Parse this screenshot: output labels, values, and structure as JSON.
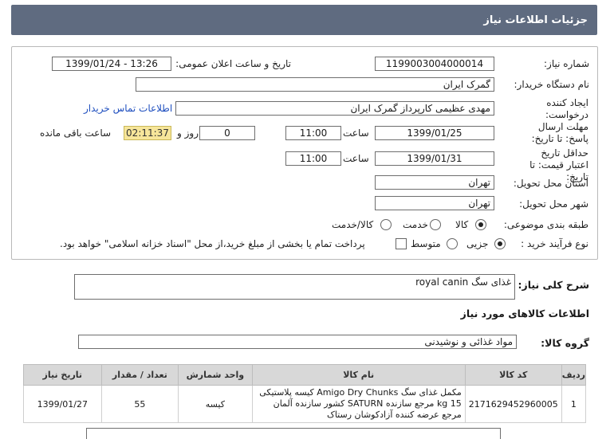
{
  "title": "جزئیات اطلاعات نیاز",
  "labels": {
    "need_number": "شماره نیاز:",
    "announce_datetime": "تاریخ و ساعت اعلان عمومی:",
    "buyer_org": "نام دستگاه خریدار:",
    "requester": "ایجاد کننده درخواست:",
    "contact_info": "اطلاعات تماس خریدار",
    "reply_deadline": "مهلت ارسال پاسخ: تا تاریخ:",
    "time_word": "ساعت",
    "day_and": "روز و",
    "remaining": "ساعت باقی مانده",
    "validity": "حداقل تاریخ اعتبار قیمت: تا تاریخ:",
    "province": "استان محل تحویل:",
    "city": "شهر محل تحویل:",
    "category": "طبقه بندی موضوعی:",
    "purchase_type": "نوع فرآیند خرید :",
    "general_desc": "شرح کلی نیاز:",
    "goods_info": "اطلاعات کالاهای مورد نیاز",
    "goods_group": "گروه کالا:"
  },
  "values": {
    "need_number": "1199003004000014",
    "announce_datetime": "1399/01/24 - 13:26",
    "buyer_org": "گمرک ایران",
    "requester": "مهدی عظیمی کارپرداز گمرک ایران",
    "reply_date": "1399/01/25",
    "reply_time": "11:00",
    "days": "0",
    "countdown": "02:11:37",
    "validity_date": "1399/01/31",
    "validity_time": "11:00",
    "province": "تهران",
    "city": "تهران",
    "general_desc": "غذای سگ royal canin",
    "goods_group": "مواد غذائی و نوشیدنی"
  },
  "category_options": [
    {
      "label": "کالا",
      "selected": true
    },
    {
      "label": "خدمت",
      "selected": false
    },
    {
      "label": "کالا/خدمت",
      "selected": false
    }
  ],
  "purchase_options": [
    {
      "label": "جزیی",
      "selected": true
    },
    {
      "label": "متوسط",
      "selected": false
    }
  ],
  "payment_note": "پرداخت تمام یا بخشی از مبلغ خرید،از محل \"اسناد خزانه اسلامی\" خواهد بود.",
  "table": {
    "headers": [
      "ردیف",
      "کد کالا",
      "نام کالا",
      "واحد شمارش",
      "تعداد / مقدار",
      "تاریخ نیاز"
    ],
    "rows": [
      {
        "index": "1",
        "code": "2171629452960005",
        "name": "مکمل غذای سگ Amigo Dry Chunks کیسه پلاستیکی 15 kg مرجع سازنده SATURN کشور سازنده آلمان مرجع عرضه کننده آزادکوشان رستاک",
        "unit": "کیسه",
        "qty": "55",
        "date": "1399/01/27"
      }
    ]
  }
}
